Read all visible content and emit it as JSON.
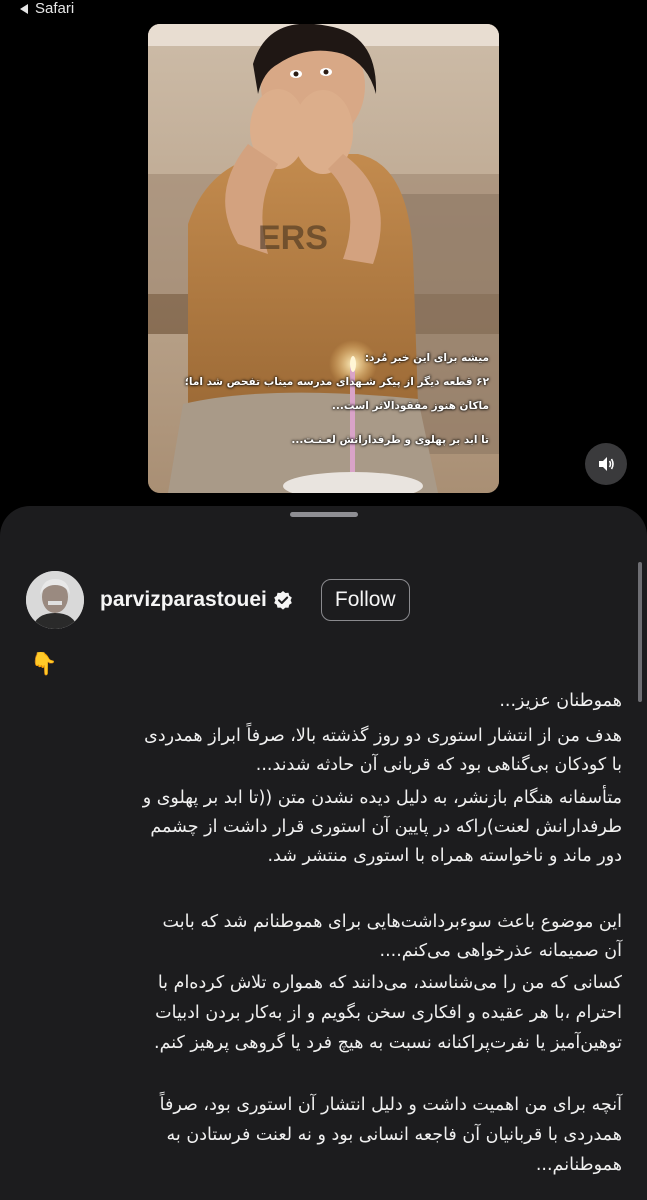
{
  "statusbar": {
    "back_label": "Safari"
  },
  "story": {
    "overlay_lines": [
      "میشه برای این خبر مُرد:",
      "۶۲ قطعه دیگر از پیکر شـهدای مدرسه میناب تفحص شد اما؛",
      "ماکان هنوز مفقودالاثر است...",
      "تا ابد بر پهلوی و طرفدارانش لعـنـت..."
    ]
  },
  "sound_icon": "speaker-icon",
  "profile": {
    "username": "parvizparastouei",
    "verified_icon": "verified-badge-icon",
    "follow_label": "Follow"
  },
  "post": {
    "emoji": "👇",
    "greeting": "هموطنان عزیز...",
    "paragraphs": [
      [
        "هدف من از انتشار استوری  دو روز گذشته بالا، صرفاً ابراز همدردی",
        "با کودکان بی‌گناهی بود که قربانی آن حادثه شدند..."
      ],
      [
        "متأسفانه هنگام بازنشر، به دلیل دیده نشدن متن ((تا ابد بر پهلوی و",
        "طرفدارانش لعنت)راکه در پایین آن استوری قرار داشت از چشمم",
        "دور ماند و ناخواسته همراه با استوری منتشر شد."
      ],
      [
        "این موضوع باعث سوء‌برداشت‌هایی برای هموطنانم  شد که بابت",
        "آن صمیمانه عذرخواهی می‌کنم...."
      ],
      [
        "کسانی که من را می‌شناسند، می‌دانند که همواره تلاش کرده‌ام با",
        "احترام ،با هر عقیده و افکاری سخن بگویم و از به‌کار بردن ادبیات",
        "توهین‌آمیز یا نفرت‌پراکنانه نسبت به هیچ فرد یا گروهی پرهیز کنم."
      ],
      [
        "آنچه برای من اهمیت داشت و دلیل انتشار آن استوری بود، صرفاً",
        "همدردی با قربانیان آن فاجعه انسانی بود و نه لعنت فرستادن به",
        "هموطنانم..."
      ]
    ]
  }
}
